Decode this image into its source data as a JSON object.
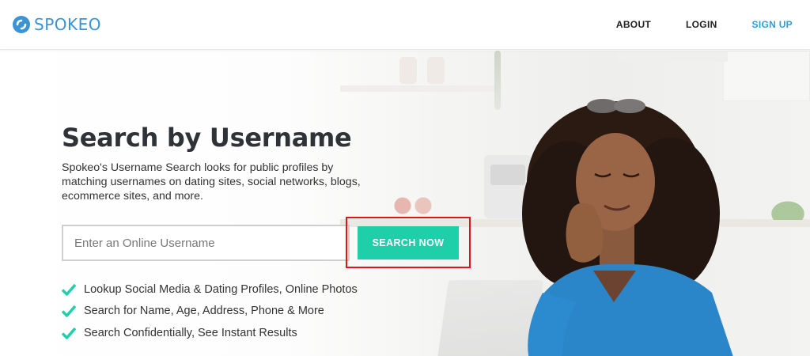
{
  "header": {
    "brand": "SPOKEO",
    "nav": [
      {
        "label": "ABOUT"
      },
      {
        "label": "LOGIN"
      },
      {
        "label": "SIGN UP"
      }
    ]
  },
  "hero": {
    "title": "Search by Username",
    "description": "Spokeo's Username Search looks for public profiles by matching usernames on dating sites, social networks, blogs, ecommerce sites, and more.",
    "search": {
      "placeholder": "Enter an Online Username",
      "value": "",
      "button_label": "SEARCH NOW"
    },
    "features": [
      "Lookup Social Media & Dating Profiles, Online Photos",
      "Search for Name, Age, Address, Phone & More",
      "Search Confidentially, See Instant Results"
    ]
  },
  "icons": {
    "logo": "spokeo-logo-icon",
    "feature_bullet": "check-icon"
  },
  "colors": {
    "brand_blue": "#3a93d3",
    "signup_link": "#2aa1d8",
    "button": "#1ecfa9",
    "check": "#1ecfa9",
    "highlight": "#e2141a"
  }
}
